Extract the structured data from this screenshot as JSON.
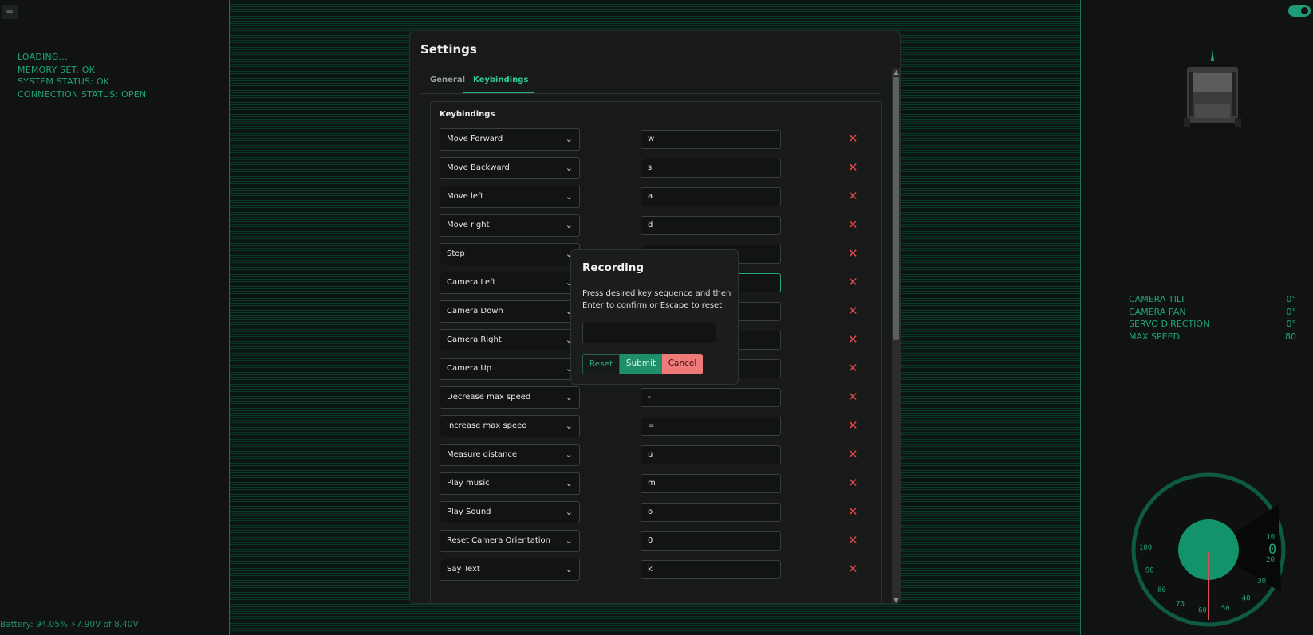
{
  "left": {
    "status_lines": [
      "LOADING...",
      "MEMORY SET: OK",
      "SYSTEM STATUS: OK",
      "CONNECTION STATUS: OPEN"
    ],
    "battery": "Battery: 94.05% ⚡7.90V of 8.40V"
  },
  "telemetry": [
    {
      "label": "CAMERA TILT",
      "value": "0°"
    },
    {
      "label": "CAMERA PAN",
      "value": "0°"
    },
    {
      "label": "SERVO DIRECTION",
      "value": "0°"
    },
    {
      "label": "MAX SPEED",
      "value": "80"
    }
  ],
  "gauge": {
    "speed_value": "0",
    "ticks": [
      "10",
      "20",
      "30",
      "40",
      "50",
      "60",
      "70",
      "80",
      "90",
      "100"
    ]
  },
  "settings": {
    "title": "Settings",
    "tabs": [
      {
        "label": "General"
      },
      {
        "label": "Keybindings"
      }
    ],
    "active_tab": "Keybindings",
    "section_title": "Keybindings",
    "bindings": [
      {
        "action": "Move Forward",
        "key": "w"
      },
      {
        "action": "Move Backward",
        "key": "s"
      },
      {
        "action": "Move left",
        "key": "a"
      },
      {
        "action": "Move right",
        "key": "d"
      },
      {
        "action": "Stop",
        "key": ""
      },
      {
        "action": "Camera Left",
        "key": ""
      },
      {
        "action": "Camera Down",
        "key": ""
      },
      {
        "action": "Camera Right",
        "key": ""
      },
      {
        "action": "Camera Up",
        "key": ""
      },
      {
        "action": "Decrease max speed",
        "key": "-"
      },
      {
        "action": "Increase max speed",
        "key": "="
      },
      {
        "action": "Measure distance",
        "key": "u"
      },
      {
        "action": "Play music",
        "key": "m"
      },
      {
        "action": "Play Sound",
        "key": "o"
      },
      {
        "action": "Reset Camera Orientation",
        "key": "0"
      },
      {
        "action": "Say Text",
        "key": "k"
      }
    ],
    "delete_glyph": "✕",
    "chevron_glyph": "⌄"
  },
  "recording": {
    "title": "Recording",
    "description": "Press desired key sequence and then Enter to confirm or Escape to reset",
    "input_value": "",
    "reset_label": "Reset",
    "submit_label": "Submit",
    "cancel_label": "Cancel"
  },
  "colors": {
    "accent": "#1fa37a",
    "danger": "#e04a4a",
    "cancel": "#f07a7a"
  }
}
